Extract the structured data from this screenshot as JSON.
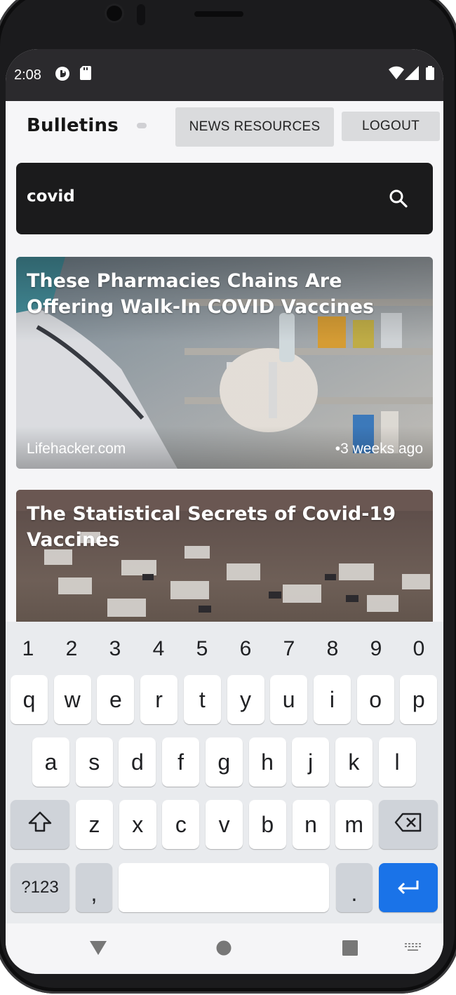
{
  "status_bar": {
    "time": "2:08"
  },
  "header": {
    "app_title": "Bulletins",
    "news_resources_label": "NEWS RESOURCES",
    "logout_label": "LOGOUT"
  },
  "search": {
    "value": "covid",
    "icon": "search-icon"
  },
  "articles": [
    {
      "title": "These Pharmacies Chains Are Offering Walk-In COVID Vaccines",
      "source": "Lifehacker.com",
      "time": "•3 weeks ago"
    },
    {
      "title": "The Statistical Secrets of Covid-19 Vaccines"
    }
  ],
  "keyboard": {
    "numbers": [
      "1",
      "2",
      "3",
      "4",
      "5",
      "6",
      "7",
      "8",
      "9",
      "0"
    ],
    "row1": [
      "q",
      "w",
      "e",
      "r",
      "t",
      "y",
      "u",
      "i",
      "o",
      "p"
    ],
    "row2": [
      "a",
      "s",
      "d",
      "f",
      "g",
      "h",
      "j",
      "k",
      "l"
    ],
    "row3": [
      "z",
      "x",
      "c",
      "v",
      "b",
      "n",
      "m"
    ],
    "symbols_label": "?123",
    "comma": ",",
    "period": "."
  },
  "colors": {
    "status_bar": "#2b2a2d",
    "search_bg": "#1b1b1c",
    "button_bg": "#dadbdd",
    "enter_key": "#1a73e8",
    "keyboard_bg": "#e9ebee"
  }
}
